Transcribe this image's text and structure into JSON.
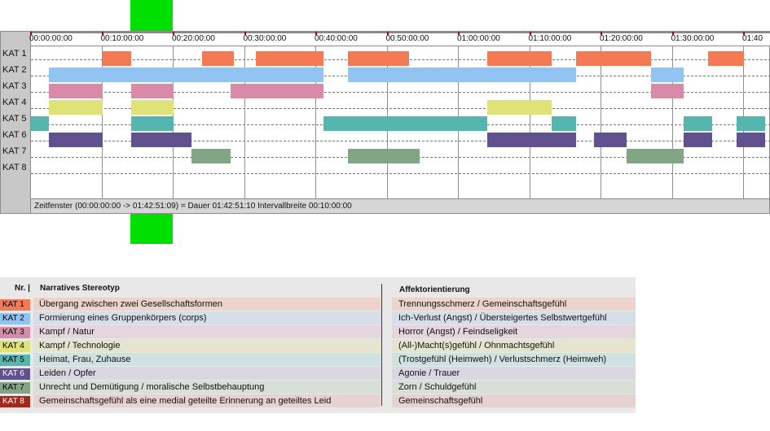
{
  "colors": {
    "kat1": "#f47a56",
    "kat2": "#91c4f2",
    "kat3": "#d98aa8",
    "kat4": "#dfe276",
    "kat5": "#55b6b0",
    "kat6": "#61518f",
    "kat7": "#82a586",
    "kat8": "#a0281c",
    "highlight": "#00e000"
  },
  "timeline": {
    "time_labels": [
      "00:00:00:00",
      "00:10:00:00",
      "00:20:00:00",
      "00:30:00:00",
      "00:40:00:00",
      "00:50:00:00",
      "01:00:00:00",
      "01:10:00:00",
      "01:20:00:00",
      "01:30:00:00",
      "01:40"
    ],
    "categories": [
      "KAT 1",
      "KAT 2",
      "KAT 3",
      "KAT 4",
      "KAT 5",
      "KAT 6",
      "KAT 7",
      "KAT 8"
    ],
    "status_text": "Zeitfenster (00:00:00:00 -> 01:42:51:09) = Dauer 01:42:51:10     Intervallbreite 00:10:00:00",
    "segments_minutes": [
      [
        [
          10,
          14
        ],
        [
          24,
          28.5
        ],
        [
          31.5,
          41
        ],
        [
          44.5,
          53
        ],
        [
          64,
          73
        ],
        [
          76.5,
          87
        ],
        [
          95,
          100
        ]
      ],
      [
        [
          2.5,
          41
        ],
        [
          44.5,
          76.5
        ],
        [
          87,
          91.5
        ]
      ],
      [
        [
          2.5,
          10
        ],
        [
          14,
          20
        ],
        [
          28,
          41
        ],
        [
          87,
          91.5
        ]
      ],
      [
        [
          2.5,
          10
        ],
        [
          14,
          20
        ],
        [
          64,
          73
        ]
      ],
      [
        [
          0,
          2.5
        ],
        [
          14,
          20
        ],
        [
          41,
          64
        ],
        [
          73,
          76.5
        ],
        [
          91.5,
          95.5
        ],
        [
          99,
          103
        ]
      ],
      [
        [
          2.5,
          10
        ],
        [
          14,
          22.5
        ],
        [
          64,
          76.5
        ],
        [
          79,
          83.5
        ],
        [
          91.5,
          95.5
        ],
        [
          99,
          103
        ]
      ],
      [
        [
          22.5,
          28
        ],
        [
          44.5,
          54.5
        ],
        [
          83.5,
          91.5
        ]
      ],
      []
    ]
  },
  "legend": {
    "header_nr": "Nr. |",
    "header_stereotype": "Narratives Stereotyp",
    "header_affekt": "Affektorientierung",
    "rows": [
      {
        "code": "KAT 1",
        "stereotype": "Übergang zwischen zwei Gesellschaftsformen",
        "affekt": "Trennungsschmerz / Gemeinschaftsgefühl",
        "row_bg": "#ecd3cc",
        "text_color": "#000000"
      },
      {
        "code": "KAT 2",
        "stereotype": "Formierung eines Gruppenkörpers (corps)",
        "affekt": "Ich-Verlust (Angst) / Übersteigertes Selbstwertgefühl",
        "row_bg": "#d6dee9",
        "text_color": "#000000"
      },
      {
        "code": "KAT 3",
        "stereotype": "Kampf / Natur",
        "affekt": "Horror (Angst) / Feindseligkeit",
        "row_bg": "#e5d5dc",
        "text_color": "#000000"
      },
      {
        "code": "KAT 4",
        "stereotype": "Kampf / Technologie",
        "affekt": "(All-)Macht(s)gefühl / Ohnmachtsgefühl",
        "row_bg": "#e5e5cf",
        "text_color": "#000000"
      },
      {
        "code": "KAT 5",
        "stereotype": "Heimat, Frau, Zuhause",
        "affekt": "(Trostgefühl (Heimweh) / Verlustschmerz (Heimweh)",
        "row_bg": "#cfe1e0",
        "text_color": "#000000"
      },
      {
        "code": "KAT 6",
        "stereotype": "Leiden / Opfer",
        "affekt": "Agonie / Trauer",
        "row_bg": "#d9d7df",
        "text_color": "#ffffff"
      },
      {
        "code": "KAT 7",
        "stereotype": "Unrecht und Demütigung / moralische Selbstbehauptung",
        "affekt": "Zorn / Schuldgefühl",
        "row_bg": "#d8dfd8",
        "text_color": "#000000"
      },
      {
        "code": "KAT 8",
        "stereotype": "Gemeinschaftsgefühl als eine medial geteilte Erinnerung an geteiltes Leid",
        "affekt": "Gemeinschaftsgefühl",
        "row_bg": "#e6d2d0",
        "text_color": "#ffffff"
      }
    ]
  }
}
